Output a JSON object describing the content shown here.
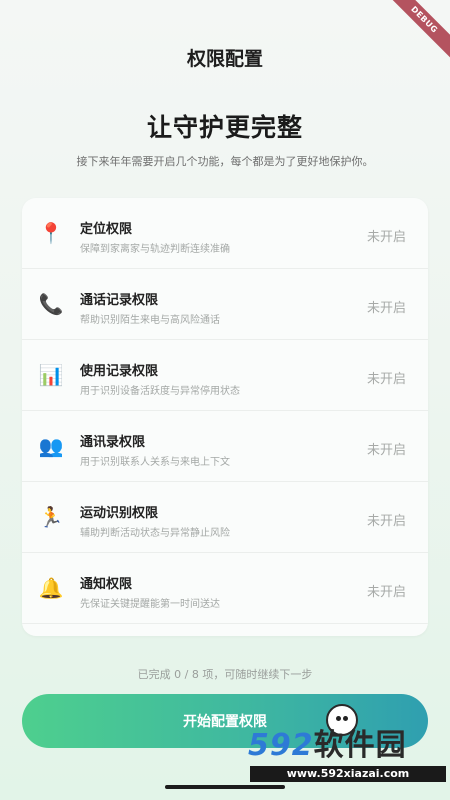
{
  "debug_banner": "DEBUG",
  "header": {
    "title": "权限配置"
  },
  "hero": {
    "title": "让守护更完整",
    "subtitle": "接下来年年需要开启几个功能，每个都是为了更好地保护你。"
  },
  "permissions": [
    {
      "icon": "location-pin-icon",
      "glyph": "📍",
      "name": "定位权限",
      "desc": "保障到家离家与轨迹判断连续准确",
      "status": "未开启"
    },
    {
      "icon": "phone-icon",
      "glyph": "📞",
      "name": "通话记录权限",
      "desc": "帮助识别陌生来电与高风险通话",
      "status": "未开启"
    },
    {
      "icon": "bar-chart-icon",
      "glyph": "📊",
      "name": "使用记录权限",
      "desc": "用于识别设备活跃度与异常停用状态",
      "status": "未开启"
    },
    {
      "icon": "people-icon",
      "glyph": "👥",
      "name": "通讯录权限",
      "desc": "用于识别联系人关系与来电上下文",
      "status": "未开启"
    },
    {
      "icon": "running-person-icon",
      "glyph": "🏃",
      "name": "运动识别权限",
      "desc": "辅助判断活动状态与异常静止风险",
      "status": "未开启"
    },
    {
      "icon": "bell-icon",
      "glyph": "🔔",
      "name": "通知权限",
      "desc": "先保证关键提醒能第一时间送达",
      "status": "未开启"
    }
  ],
  "progress_text": "已完成 0 / 8 项，可随时继续下一步",
  "primary_button": "开始配置权限",
  "watermark": {
    "digits": "592",
    "text": "软件园",
    "url": "www.592xiazai.com"
  }
}
